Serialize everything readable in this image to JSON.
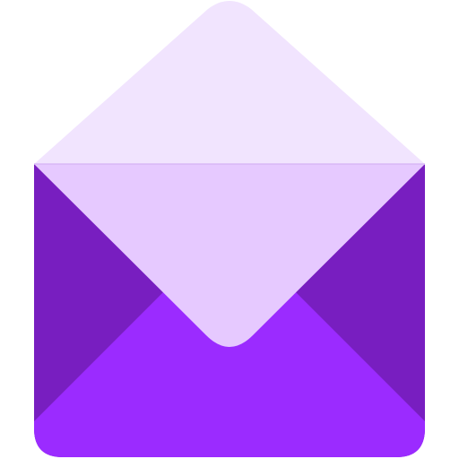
{
  "icon": {
    "name": "open-envelope-icon",
    "colors": {
      "flap_outer": "#F1E4FE",
      "flap_inner": "#E6C9FF",
      "side_panels": "#781EC0",
      "bottom_panel": "#9B2BFF",
      "seam_line": "#D9B8F5"
    }
  }
}
